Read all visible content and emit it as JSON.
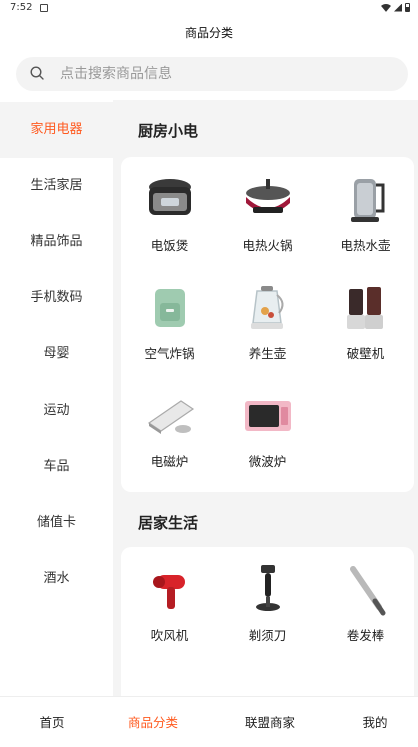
{
  "status_bar": {
    "time": "7:52"
  },
  "header": {
    "title": "商品分类"
  },
  "search": {
    "placeholder": "点击搜索商品信息"
  },
  "sidebar": {
    "items": [
      {
        "label": "家用电器",
        "active": true
      },
      {
        "label": "生活家居"
      },
      {
        "label": "精品饰品"
      },
      {
        "label": "手机数码"
      },
      {
        "label": "母婴"
      },
      {
        "label": "运动"
      },
      {
        "label": "车品"
      },
      {
        "label": "储值卡"
      },
      {
        "label": "酒水"
      }
    ]
  },
  "sections": [
    {
      "title": "厨房小电",
      "products": [
        {
          "label": "电饭煲",
          "icon": "rice-cooker-icon"
        },
        {
          "label": "电热火锅",
          "icon": "hot-pot-icon"
        },
        {
          "label": "电热水壶",
          "icon": "kettle-icon"
        },
        {
          "label": "空气炸锅",
          "icon": "air-fryer-icon"
        },
        {
          "label": "养生壶",
          "icon": "health-pot-icon"
        },
        {
          "label": "破壁机",
          "icon": "blender-icon"
        },
        {
          "label": "电磁炉",
          "icon": "induction-cooker-icon"
        },
        {
          "label": "微波炉",
          "icon": "microwave-icon"
        }
      ]
    },
    {
      "title": "居家生活",
      "products": [
        {
          "label": "吹风机",
          "icon": "hair-dryer-icon"
        },
        {
          "label": "剃须刀",
          "icon": "shaver-icon"
        },
        {
          "label": "卷发棒",
          "icon": "curling-iron-icon"
        }
      ]
    }
  ],
  "tabbar": {
    "items": [
      {
        "label": "首页"
      },
      {
        "label": "商品分类",
        "active": true
      },
      {
        "label": "联盟商家"
      },
      {
        "label": "我的"
      }
    ]
  },
  "colors": {
    "accent": "#ff5a1f",
    "background": "#f4f4f4"
  }
}
